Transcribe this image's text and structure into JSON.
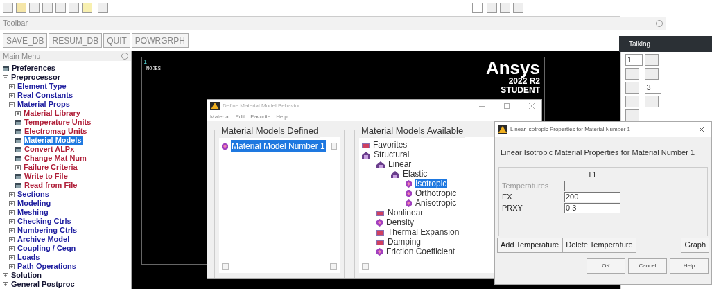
{
  "toolbar": {
    "label": "Toolbar",
    "buttons": [
      "SAVE_DB",
      "RESUM_DB",
      "QUIT",
      "POWRGRPH"
    ]
  },
  "talking_badge": "Talking",
  "view_selectors": [
    "1",
    "3"
  ],
  "main_menu": {
    "title": "Main Menu",
    "items": [
      {
        "label": "Preferences",
        "kind": "leaf",
        "selected": false
      },
      {
        "label": "Preprocessor",
        "kind": "branch",
        "expanded": true,
        "selected": false,
        "children": [
          {
            "label": "Element Type",
            "kind": "branch",
            "expanded": false,
            "selected": false
          },
          {
            "label": "Real Constants",
            "kind": "branch",
            "expanded": false,
            "selected": false
          },
          {
            "label": "Material Props",
            "kind": "branch",
            "expanded": true,
            "selected": false,
            "children": [
              {
                "label": "Material Library",
                "kind": "branch",
                "expanded": false,
                "selected": false
              },
              {
                "label": "Temperature Units",
                "kind": "leaf",
                "selected": false
              },
              {
                "label": "Electromag Units",
                "kind": "leaf",
                "selected": false
              },
              {
                "label": "Material Models",
                "kind": "leaf",
                "selected": true
              },
              {
                "label": "Convert ALPx",
                "kind": "leaf",
                "selected": false
              },
              {
                "label": "Change Mat Num",
                "kind": "leaf",
                "selected": false
              },
              {
                "label": "Failure Criteria",
                "kind": "branch",
                "expanded": false,
                "selected": false
              },
              {
                "label": "Write to File",
                "kind": "leaf",
                "selected": false
              },
              {
                "label": "Read from File",
                "kind": "leaf",
                "selected": false
              }
            ]
          },
          {
            "label": "Sections",
            "kind": "branch",
            "expanded": false,
            "selected": false
          },
          {
            "label": "Modeling",
            "kind": "branch",
            "expanded": false,
            "selected": false
          },
          {
            "label": "Meshing",
            "kind": "branch",
            "expanded": false,
            "selected": false
          },
          {
            "label": "Checking Ctrls",
            "kind": "branch",
            "expanded": false,
            "selected": false
          },
          {
            "label": "Numbering Ctrls",
            "kind": "branch",
            "expanded": false,
            "selected": false
          },
          {
            "label": "Archive Model",
            "kind": "branch",
            "expanded": false,
            "selected": false
          },
          {
            "label": "Coupling / Ceqn",
            "kind": "branch",
            "expanded": false,
            "selected": false
          },
          {
            "label": "Loads",
            "kind": "branch",
            "expanded": false,
            "selected": false
          },
          {
            "label": "Path Operations",
            "kind": "branch",
            "expanded": false,
            "selected": false
          }
        ]
      },
      {
        "label": "Solution",
        "kind": "branch",
        "expanded": false,
        "selected": false
      },
      {
        "label": "General Postproc",
        "kind": "branch",
        "expanded": false,
        "selected": false
      }
    ]
  },
  "graphics": {
    "window_number": "1",
    "label": "NODES",
    "logo": "Ansys",
    "version": "2022 R2",
    "edition": "STUDENT"
  },
  "define_dialog": {
    "title": "Define Material Model Behavior",
    "menu": [
      "Material",
      "Edit",
      "Favorite",
      "Help"
    ],
    "defined": {
      "title": "Material Models Defined",
      "items": [
        {
          "label": "Material Model Number 1",
          "selected": true
        }
      ]
    },
    "available": {
      "title": "Material Models Available",
      "items": [
        {
          "label": "Favorites",
          "kind": "folder",
          "selected": false
        },
        {
          "label": "Structural",
          "kind": "category",
          "selected": false,
          "children": [
            {
              "label": "Linear",
              "kind": "category",
              "selected": false,
              "children": [
                {
                  "label": "Elastic",
                  "kind": "category",
                  "selected": false,
                  "children": [
                    {
                      "label": "Isotropic",
                      "kind": "model",
                      "selected": true
                    },
                    {
                      "label": "Orthotropic",
                      "kind": "model",
                      "selected": false
                    },
                    {
                      "label": "Anisotropic",
                      "kind": "model",
                      "selected": false
                    }
                  ]
                }
              ]
            },
            {
              "label": "Nonlinear",
              "kind": "folder",
              "selected": false
            },
            {
              "label": "Density",
              "kind": "model",
              "selected": false
            },
            {
              "label": "Thermal Expansion",
              "kind": "folder",
              "selected": false
            },
            {
              "label": "Damping",
              "kind": "folder",
              "selected": false
            },
            {
              "label": "Friction Coefficient",
              "kind": "model",
              "selected": false
            }
          ]
        }
      ]
    }
  },
  "props_dialog": {
    "title": "Linear Isotropic Properties for Material Number 1",
    "heading": "Linear Isotropic Material Properties for Material Number 1",
    "column": "T1",
    "rows": [
      {
        "label": "Temperatures",
        "value": "",
        "disabled": true
      },
      {
        "label": "EX",
        "value": "200",
        "disabled": false
      },
      {
        "label": "PRXY",
        "value": "0.3",
        "disabled": false
      }
    ],
    "buttons": [
      "Add Temperature",
      "Delete Temperature",
      "Graph"
    ],
    "footer": [
      "OK",
      "Cancel",
      "Help"
    ]
  }
}
